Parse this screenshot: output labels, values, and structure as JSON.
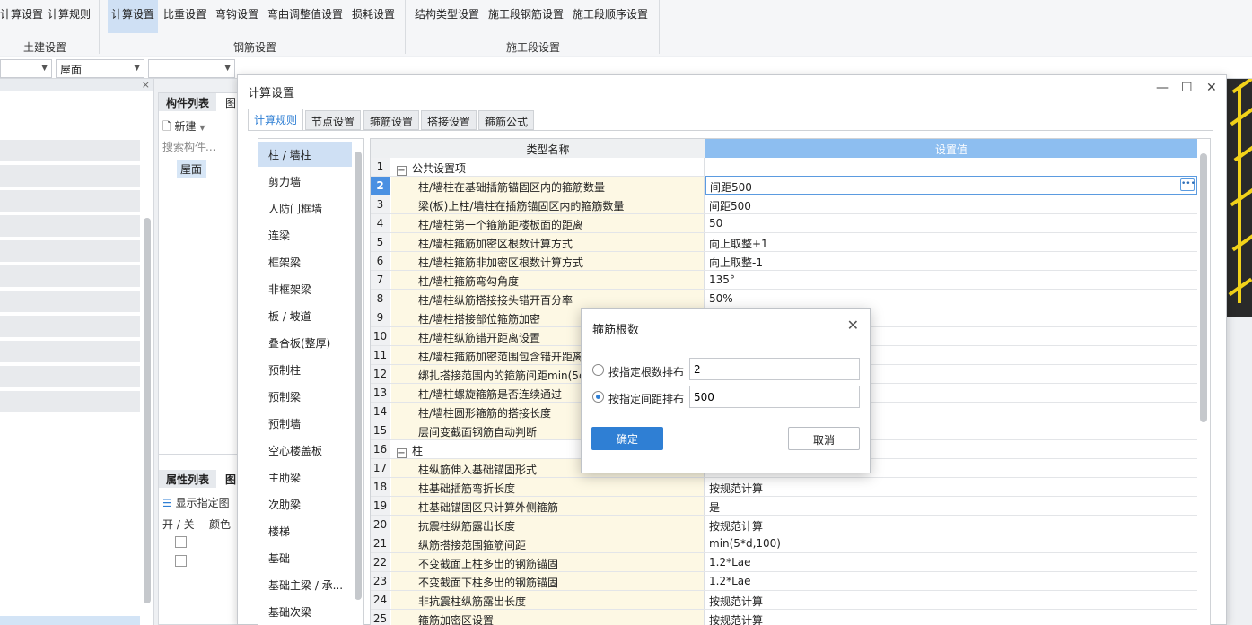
{
  "ribbon": {
    "buttons": [
      "计算设置",
      "计算规则",
      "计算设置",
      "比重设置",
      "弯钩设置",
      "弯曲调整值设置",
      "损耗设置",
      "结构类型设置",
      "施工段钢筋设置",
      "施工段顺序设置"
    ],
    "groups": [
      "土建设置",
      "钢筋设置",
      "施工段设置"
    ]
  },
  "toolbar": {
    "floor": "屋面",
    "close": "×"
  },
  "component_panel": {
    "tab_list": "构件列表",
    "tab_graph": "图",
    "new_button": "新建",
    "search_placeholder": "搜索构件...",
    "item": "屋面",
    "tab_props": "属性列表",
    "tab_props2": "图",
    "show_layer": "显示指定图",
    "col_onoff": "开 / 关",
    "col_color": "颜色"
  },
  "dialog": {
    "title": "计算设置",
    "minimize": "—",
    "maximize": "☐",
    "close": "✕",
    "tabs": [
      "计算规则",
      "节点设置",
      "箍筋设置",
      "搭接设置",
      "箍筋公式"
    ],
    "categories": [
      "柱 / 墙柱",
      "剪力墙",
      "人防门框墙",
      "连梁",
      "框架梁",
      "非框架梁",
      "板 / 坡道",
      "叠合板(整厚)",
      "预制柱",
      "预制梁",
      "预制墙",
      "空心楼盖板",
      "主肋梁",
      "次肋梁",
      "楼梯",
      "基础",
      "基础主梁 / 承...",
      "基础次梁"
    ],
    "grid": {
      "col_name": "类型名称",
      "col_value": "设置值",
      "rows": [
        {
          "n": "1",
          "name": "公共设置项",
          "value": "",
          "group": true
        },
        {
          "n": "2",
          "name": "柱/墙柱在基础插筋锚固区内的箍筋数量",
          "value": "间距500"
        },
        {
          "n": "3",
          "name": "梁(板)上柱/墙柱在插筋锚固区内的箍筋数量",
          "value": "间距500"
        },
        {
          "n": "4",
          "name": "柱/墙柱第一个箍筋距楼板面的距离",
          "value": "50"
        },
        {
          "n": "5",
          "name": "柱/墙柱箍筋加密区根数计算方式",
          "value": "向上取整+1"
        },
        {
          "n": "6",
          "name": "柱/墙柱箍筋非加密区根数计算方式",
          "value": "向上取整-1"
        },
        {
          "n": "7",
          "name": "柱/墙柱箍筋弯勾角度",
          "value": "135°"
        },
        {
          "n": "8",
          "name": "柱/墙柱纵筋搭接接头错开百分率",
          "value": "50%"
        },
        {
          "n": "9",
          "name": "柱/墙柱搭接部位箍筋加密",
          "value": ""
        },
        {
          "n": "10",
          "name": "柱/墙柱纵筋错开距离设置",
          "value": ""
        },
        {
          "n": "11",
          "name": "柱/墙柱箍筋加密范围包含错开距离",
          "value": ""
        },
        {
          "n": "12",
          "name": "绑扎搭接范围内的箍筋间距min(5d",
          "value": ""
        },
        {
          "n": "13",
          "name": "柱/墙柱螺旋箍筋是否连续通过",
          "value": ""
        },
        {
          "n": "14",
          "name": "柱/墙柱圆形箍筋的搭接长度",
          "value": ""
        },
        {
          "n": "15",
          "name": "层间变截面钢筋自动判断",
          "value": ""
        },
        {
          "n": "16",
          "name": "柱",
          "value": "",
          "group": true
        },
        {
          "n": "17",
          "name": "柱纵筋伸入基础锚固形式",
          "value": ""
        },
        {
          "n": "18",
          "name": "柱基础插筋弯折长度",
          "value": "按规范计算"
        },
        {
          "n": "19",
          "name": "柱基础锚固区只计算外侧箍筋",
          "value": "是"
        },
        {
          "n": "20",
          "name": "抗震柱纵筋露出长度",
          "value": "按规范计算"
        },
        {
          "n": "21",
          "name": "纵筋搭接范围箍筋间距",
          "value": "min(5*d,100)"
        },
        {
          "n": "22",
          "name": "不变截面上柱多出的钢筋锚固",
          "value": "1.2*Lae"
        },
        {
          "n": "23",
          "name": "不变截面下柱多出的钢筋锚固",
          "value": "1.2*Lae"
        },
        {
          "n": "24",
          "name": "非抗震柱纵筋露出长度",
          "value": "按规范计算"
        },
        {
          "n": "25",
          "name": "箍筋加密区设置",
          "value": "按规范计算"
        }
      ]
    }
  },
  "modal": {
    "title": "箍筋根数",
    "close": "✕",
    "option1": "按指定根数排布",
    "option1_value": "2",
    "option2": "按指定间距排布",
    "option2_value": "500",
    "ok": "确定",
    "cancel": "取消"
  },
  "colors": {
    "accent": "#2f7fd4",
    "selected_row": "#4a90e2",
    "name_bg": "#fdf8e4",
    "header_blue": "#8dbef0"
  }
}
